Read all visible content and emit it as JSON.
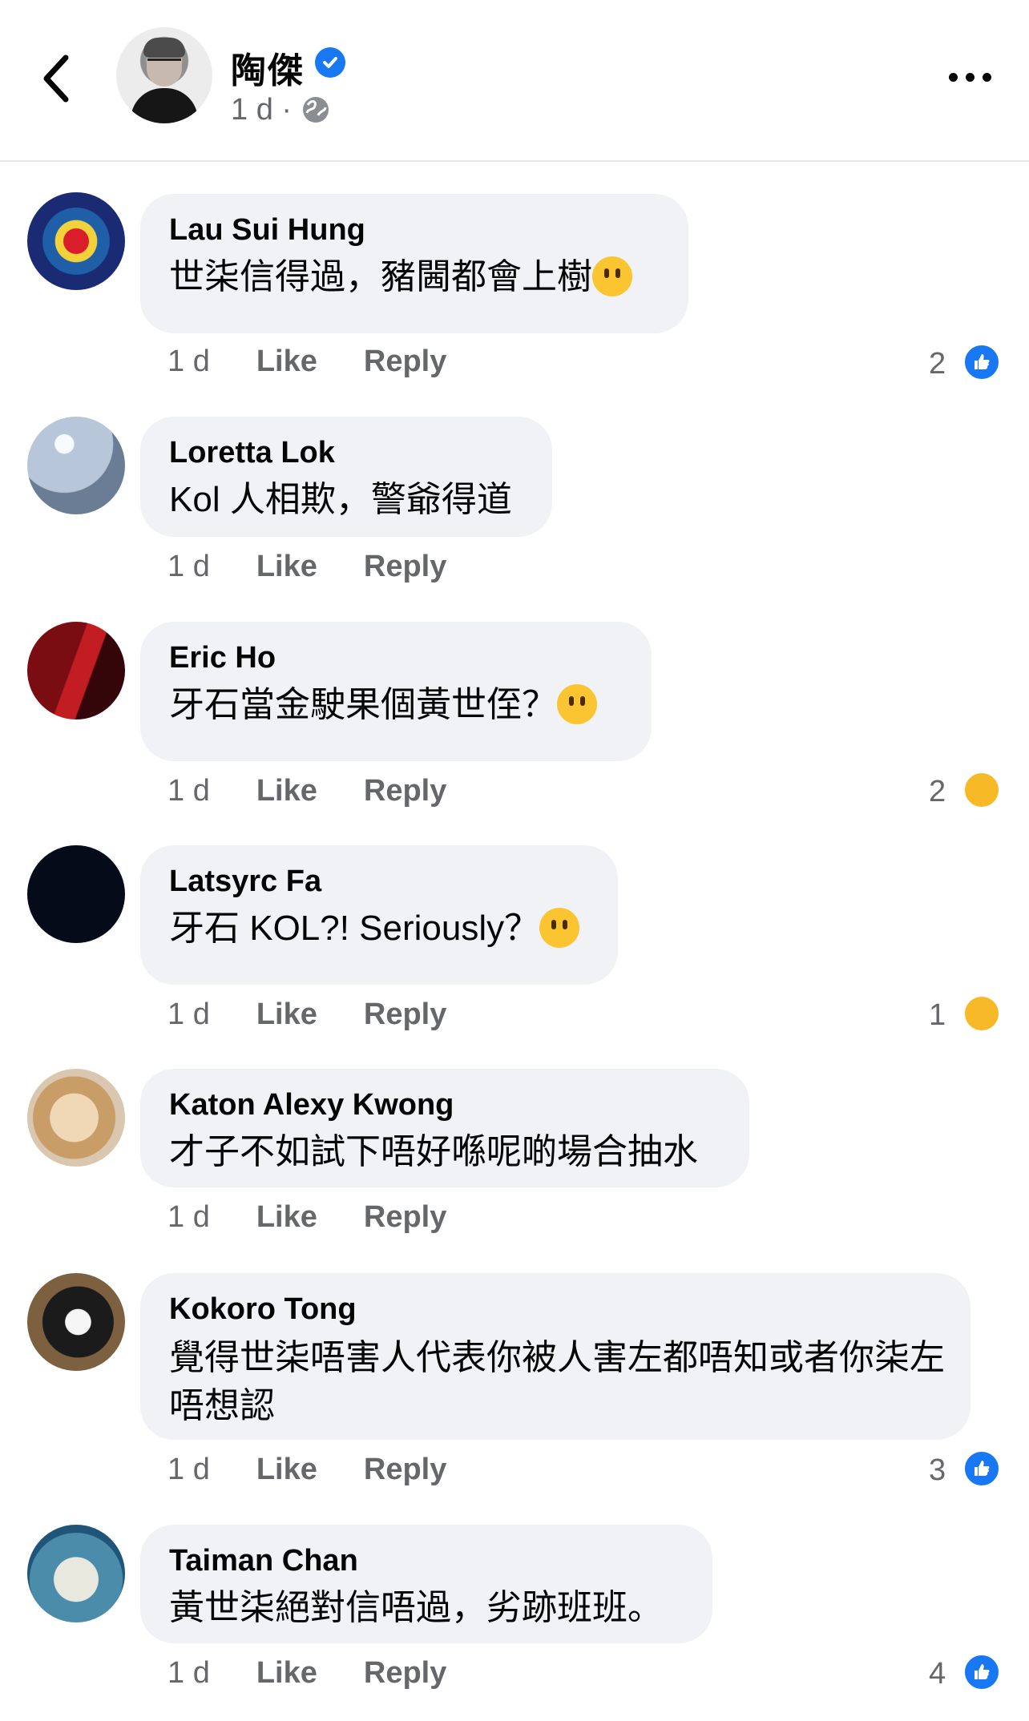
{
  "header": {
    "title": "陶傑",
    "time": "1 d ·",
    "verified_icon": "verified-check-icon",
    "privacy_icon": "globe-icon",
    "more_icon": "more-dots-icon",
    "back_icon": "chevron-left-icon"
  },
  "comments": [
    {
      "author": "Lau Sui Hung",
      "text": "世柒信得過，豬閪都會上樹",
      "time": "1 d",
      "like": "Like",
      "reply": "Reply",
      "reaction_count": "2",
      "reaction": "like"
    },
    {
      "author": "Loretta Lok",
      "text": "Kol 人相欺，警爺得道",
      "time": "1 d",
      "like": "Like",
      "reply": "Reply"
    },
    {
      "author": "Eric Ho",
      "text": "牙石當金駛果個黃世侄？",
      "time": "1 d",
      "like": "Like",
      "reply": "Reply",
      "reaction_count": "2",
      "reaction": "haha"
    },
    {
      "author": "Latsyrc Fa",
      "text": "牙石 KOL?! Seriously？",
      "time": "1 d",
      "like": "Like",
      "reply": "Reply",
      "reaction_count": "1",
      "reaction": "haha"
    },
    {
      "author": "Katon Alexy Kwong",
      "text": "才子不如試下唔好喺呢啲場合抽水",
      "time": "1 d",
      "like": "Like",
      "reply": "Reply"
    },
    {
      "author": "Kokoro Tong",
      "text": "覺得世柒唔害人代表你被人害左都唔知或者你柒左唔想認",
      "time": "1 d",
      "like": "Like",
      "reply": "Reply",
      "reaction_count": "3",
      "reaction": "like"
    },
    {
      "author": "Taiman  Chan",
      "text": "黃世柒絕對信唔過，劣跡班班。",
      "time": "1 d",
      "like": "Like",
      "reply": "Reply",
      "reaction_count": "4",
      "reaction": "like"
    }
  ]
}
